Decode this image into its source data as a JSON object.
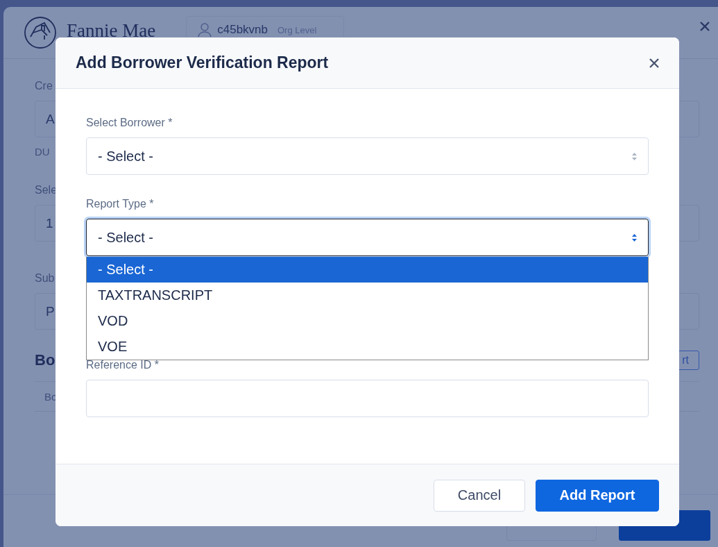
{
  "background_page": {
    "brand": "Fannie Mae",
    "user": "c45bkvnb",
    "user_level": "Org Level",
    "fields": [
      {
        "label": "Cre",
        "value": "A",
        "note": "DU"
      },
      {
        "label": "Sele",
        "value": "1"
      },
      {
        "label": "Sub",
        "value": "P"
      }
    ],
    "section_title": "Bo",
    "section_button": "rt",
    "table_header": "Bo",
    "buttons": [
      {
        "kind": "secondary"
      },
      {
        "kind": "primary"
      }
    ]
  },
  "modal": {
    "title": "Add Borrower Verification Report",
    "fields": [
      {
        "label": "Select Borrower *",
        "kind": "select",
        "value": "- Select -",
        "focused": false
      },
      {
        "label": "Report Type *",
        "kind": "select",
        "value": "- Select -",
        "focused": true,
        "options": [
          {
            "label": "- Select -",
            "selected": true
          },
          {
            "label": "TAXTRANSCRIPT",
            "selected": false
          },
          {
            "label": "VOD",
            "selected": false
          },
          {
            "label": "VOE",
            "selected": false
          }
        ]
      },
      {
        "label": "Reference ID *",
        "kind": "text"
      }
    ],
    "buttons": [
      {
        "label": "Cancel",
        "kind": "secondary"
      },
      {
        "label": "Add Report",
        "kind": "primary"
      }
    ]
  }
}
